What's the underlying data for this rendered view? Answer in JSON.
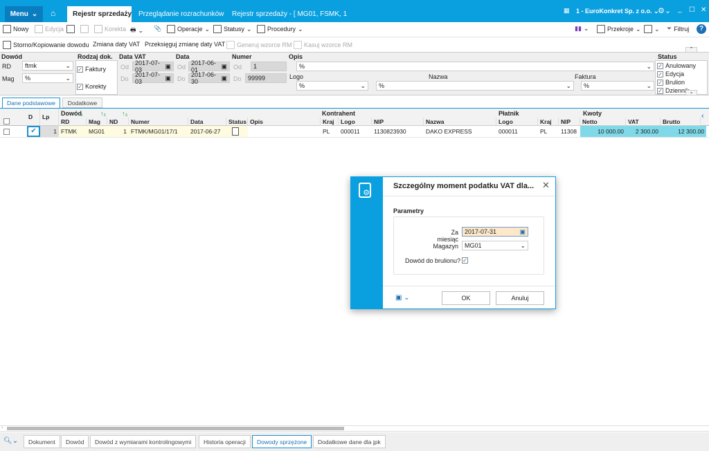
{
  "topbar": {
    "menu": "Menu",
    "tabs": [
      "Rejestr sprzedaży",
      "Przeglądanie rozrachunków",
      "Rejestr sprzedaży - [ MG01, FSMK, 1"
    ],
    "company": "1 - EuroKonkret Sp. z o.o."
  },
  "toolbar1": {
    "nowy": "Nowy",
    "edycja": "Edycja",
    "korekta": "Korekta",
    "operacje": "Operacje",
    "statusy": "Statusy",
    "procedury": "Procedury",
    "przekroje": "Przekroje",
    "filtruj": "Filtruj"
  },
  "toolbar2": {
    "storno": "Storno/Kopiowanie dowodu",
    "zmiana": "Zmiana daty VAT",
    "przeksieguj": "Przeksięguj zmianę daty VAT",
    "generuj": "Generuj wzorce RM",
    "kasuj": "Kasuj wzorce RM"
  },
  "filter": {
    "dowod": "Dowód",
    "rd_label": "RD",
    "rd_value": "ftmk",
    "mag_label": "Mag",
    "mag_value": "%",
    "rodzaj": "Rodzaj dok.",
    "faktury": "Faktury",
    "korekty": "Korekty",
    "data_vat": "Data VAT",
    "data": "Data",
    "od": "Od",
    "do": "Do",
    "vat_od": "2017-07-03",
    "vat_do": "2017-07-03",
    "data_od": "2017-06-01",
    "data_do": "2017-06-30",
    "numer": "Numer",
    "numer_od": "1",
    "numer_do": "99999",
    "opis": "Opis",
    "opis_value": "%",
    "logo": "Logo",
    "logo_value": "%",
    "nazwa": "Nazwa",
    "nazwa_value": "%",
    "faktura": "Faktura",
    "faktura_value": "%",
    "status": "Status",
    "statuses": [
      "Anulowany",
      "Edycja",
      "Brulion",
      "Dziennik"
    ]
  },
  "subtabs": [
    "Dane podstawowe",
    "Dodatkowe"
  ],
  "grid": {
    "groups": {
      "dowod": "Dowód",
      "kontrahent": "Kontrahent",
      "platnik": "Płatnik",
      "kwoty": "Kwoty"
    },
    "columns": [
      "D",
      "Lp",
      "RD",
      "Mag",
      "ND",
      "Numer",
      "Data",
      "Status",
      "Opis",
      "Kraj",
      "Logo",
      "NIP",
      "Nazwa",
      "Logo",
      "Kraj",
      "NIP",
      "Netto",
      "VAT",
      "Brutto"
    ],
    "row": {
      "lp": "1",
      "rd": "FTMK",
      "mag": "MG01",
      "nd": "1",
      "numer": "FTMK/MG01/17/1",
      "data": "2017-06-27",
      "kraj": "PL",
      "logo": "000011",
      "nip": "1130823930",
      "nazwa": "DAKO EXPRESS",
      "p_logo": "000011",
      "p_kraj": "PL",
      "p_nip": "11308",
      "netto": "10 000.00",
      "vat": "2 300.00",
      "brutto": "12 300.00"
    }
  },
  "dialog": {
    "title": "Szczególny moment podatku VAT dla...",
    "section": "Parametry",
    "za_miesiac_label": "Za miesiąc",
    "za_miesiac": "2017-07-31",
    "magazyn_label": "Magazyn",
    "magazyn": "MG01",
    "brulion_label": "Dowód do brulionu?",
    "ok": "OK",
    "anuluj": "Anuluj"
  },
  "bottom_tabs": [
    "Dokument",
    "Dowód",
    "Dowód z wymiarami kontrolingowymi",
    "Historia operacji",
    "Dowody sprzężone",
    "Dodatkowe dane dla jpk"
  ],
  "colors": {
    "accent": "#0aa0df",
    "amount_bg": "#7fd9e8",
    "row_bg": "#fffbe0"
  }
}
